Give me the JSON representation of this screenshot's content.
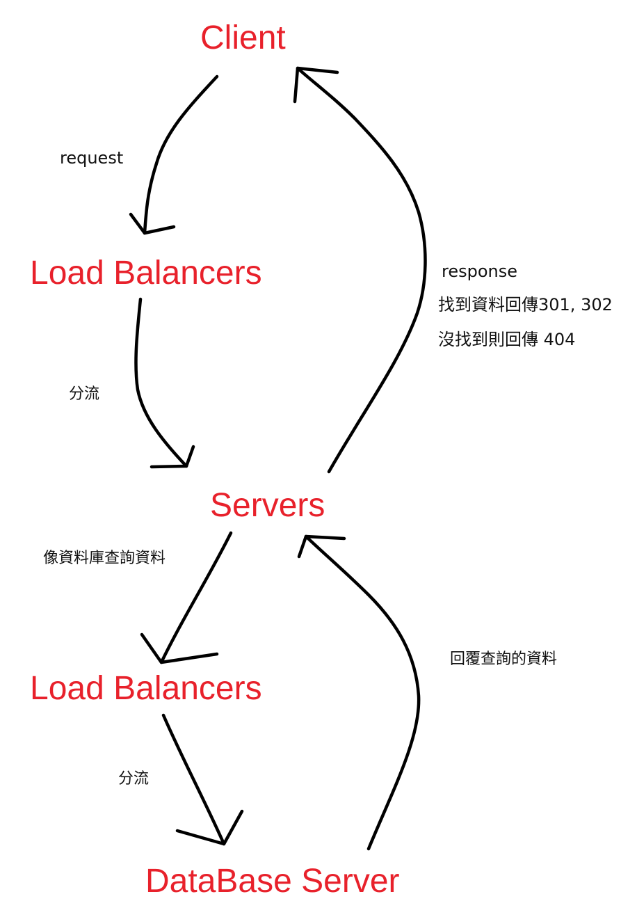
{
  "nodes": {
    "client": "Client",
    "load_balancers_1": "Load Balancers",
    "servers": "Servers",
    "load_balancers_2": "Load Balancers",
    "database_server": "DataBase Server"
  },
  "edge_labels": {
    "request": "request",
    "split_1": "分流",
    "response": "response",
    "response_found": "找到資料回傳301, 302",
    "response_not_found": "沒找到則回傳 404",
    "db_query": "像資料庫查詢資料",
    "split_2": "分流",
    "db_reply": "回覆查詢的資料"
  },
  "colors": {
    "node_text": "#e8212b",
    "label_text": "#111111",
    "arrow": "#000000"
  }
}
